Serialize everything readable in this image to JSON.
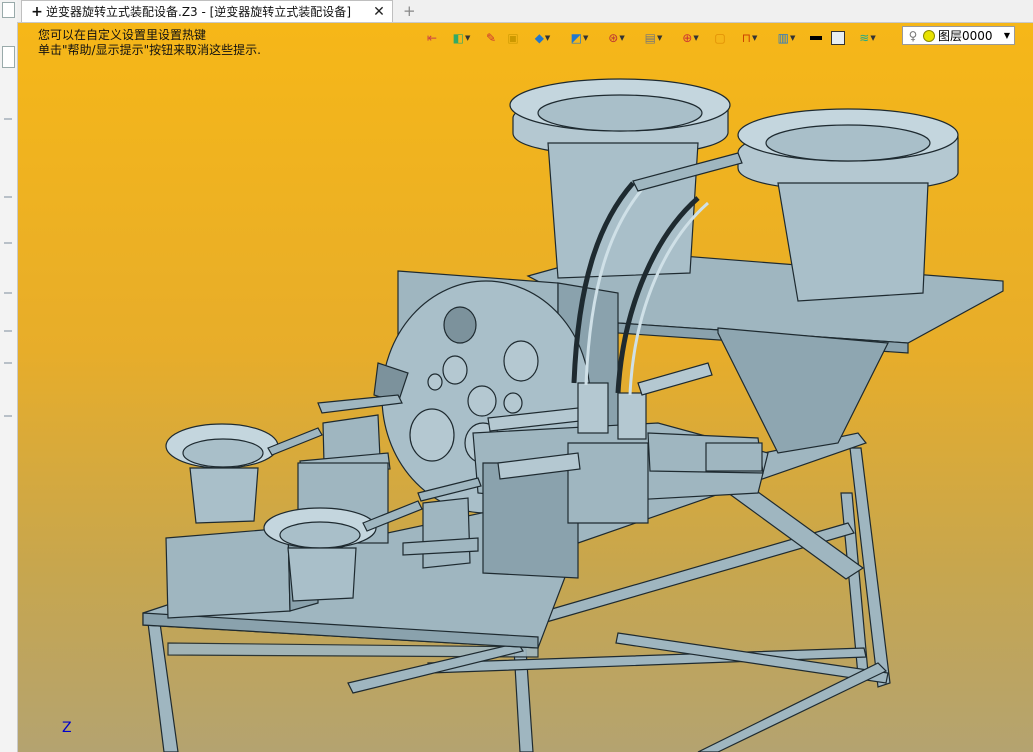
{
  "tab": {
    "title": "逆变器旋转立式装配设备.Z3 - [逆变器旋转立式装配设备]",
    "plus_icon": "+",
    "close_icon": "✕",
    "new_tab_icon": "+"
  },
  "hints": {
    "line1": "您可以在自定义设置里设置热键",
    "line2": "单击\"帮助/显示提示\"按钮来取消这些提示."
  },
  "toolbar": {
    "icons": [
      "exit-icon",
      "layer-tool-icon",
      "pencil-icon",
      "box-icon",
      "cube-icon",
      "view-icon",
      "wheel-icon",
      "image-icon",
      "target-icon",
      "frame-icon",
      "dimension-icon",
      "display-icon",
      "color-black-icon",
      "color-white-icon",
      "stack-icon"
    ]
  },
  "layer": {
    "name": "图层0000"
  },
  "axis": {
    "z_label": "Z"
  },
  "colors": {
    "viewport_top": "#f6b718",
    "viewport_bottom": "#b4a370",
    "model_fill": "#9fb6c0",
    "model_stroke": "#1e2a30"
  }
}
